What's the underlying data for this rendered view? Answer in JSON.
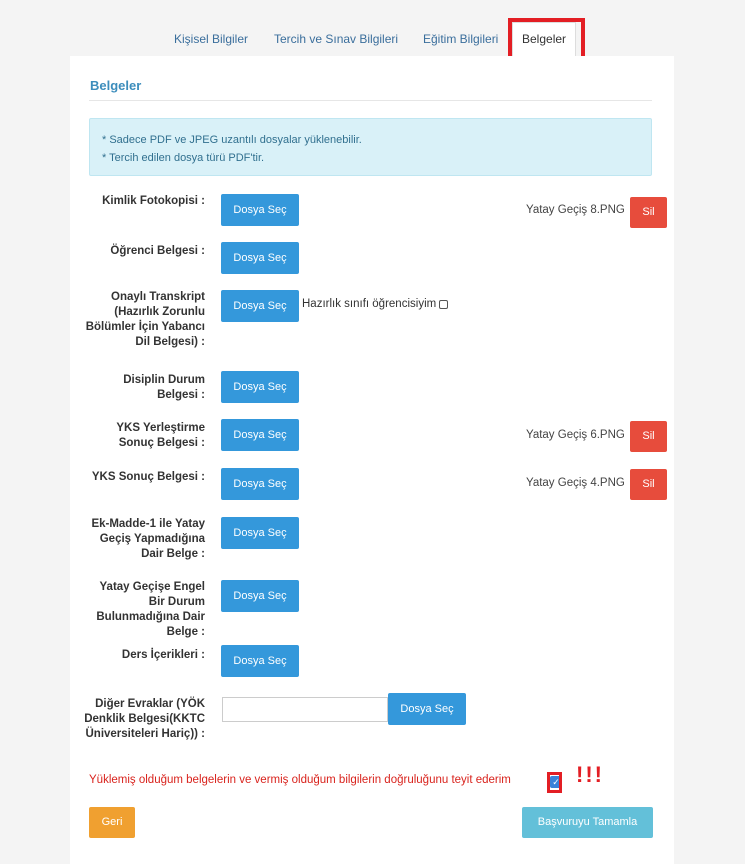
{
  "tabs": {
    "personal": "Kişisel Bilgiler",
    "preference": "Tercih ve Sınav Bilgileri",
    "education": "Eğitim Bilgileri",
    "documents": "Belgeler"
  },
  "section": {
    "title": "Belgeler",
    "info_line1": "* Sadece PDF ve JPEG uzantılı dosyalar yüklenebilir.",
    "info_line2": "* Tercih edilen dosya türü PDF'tir."
  },
  "buttons": {
    "choose_file": "Dosya Seç",
    "delete": "Sil",
    "back": "Geri",
    "complete": "Başvuruyu Tamamla"
  },
  "documents": [
    {
      "label": "Kimlik Fotokopisi :",
      "file": "Yatay Geçiş 8.PNG"
    },
    {
      "label": "Öğrenci Belgesi :",
      "file": ""
    },
    {
      "label": "Onaylı Transkript (Hazırlık Zorunlu Bölümler İçin Yabancı Dil Belgesi) :",
      "file": ""
    },
    {
      "label": "Disiplin Durum Belgesi :",
      "file": ""
    },
    {
      "label": "YKS Yerleştirme Sonuç Belgesi :",
      "file": "Yatay Geçiş 6.PNG"
    },
    {
      "label": "YKS Sonuç Belgesi :",
      "file": "Yatay Geçiş 4.PNG"
    },
    {
      "label": "Ek-Madde-1 ile Yatay Geçiş Yapmadığına Dair Belge :",
      "file": ""
    },
    {
      "label": "Yatay Geçişe Engel Bir Durum Bulunmadığına Dair Belge :",
      "file": ""
    },
    {
      "label": "Ders İçerikleri :",
      "file": ""
    },
    {
      "label": "Diğer Evraklar (YÖK Denklik Belgesi(KKTC Üniversiteleri Hariç)) :",
      "file": ""
    }
  ],
  "prep_checkbox_label": "Hazırlık sınıfı öğrencisiyim",
  "other_docs_input_value": "",
  "confirmation": {
    "text": "Yüklemiş olduğum belgelerin ve vermiş olduğum bilgilerin doğruluğunu teyit ederim",
    "checked_mark": "✓",
    "annotation": "!!!"
  },
  "colors": {
    "primary": "#3498db",
    "danger": "#e74c3c",
    "warning": "#f0a030",
    "info": "#63c0d9",
    "highlight": "#e31e24"
  }
}
